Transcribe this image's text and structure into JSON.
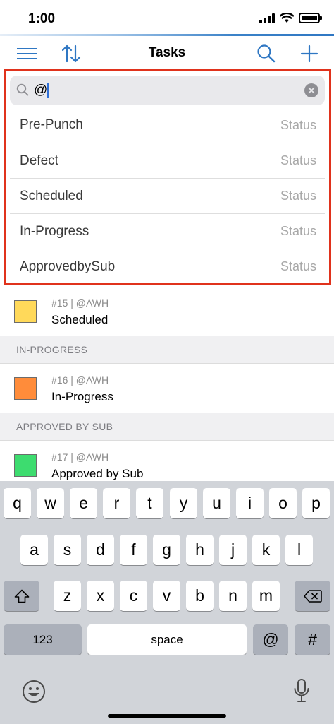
{
  "status_bar": {
    "time": "1:00"
  },
  "nav": {
    "title": "Tasks"
  },
  "search": {
    "value": "@"
  },
  "suggestions": [
    {
      "label": "Pre-Punch",
      "meta": "Status"
    },
    {
      "label": "Defect",
      "meta": "Status"
    },
    {
      "label": "Scheduled",
      "meta": "Status"
    },
    {
      "label": "In-Progress",
      "meta": "Status"
    },
    {
      "label": "ApprovedbySub",
      "meta": "Status"
    }
  ],
  "tasks": {
    "scheduled_item": {
      "meta": "#15 | @AWH",
      "title": "Scheduled",
      "color": "#ffd95a"
    },
    "in_progress_header": "IN-PROGRESS",
    "in_progress_item": {
      "meta": "#16 | @AWH",
      "title": "In-Progress",
      "color": "#ff8c3a"
    },
    "approved_header": "APPROVED BY  SUB",
    "approved_item": {
      "meta": "#17 | @AWH",
      "title": "Approved by Sub",
      "color": "#3ddc6f"
    }
  },
  "keyboard": {
    "row1": [
      "q",
      "w",
      "e",
      "r",
      "t",
      "y",
      "u",
      "i",
      "o",
      "p"
    ],
    "row2": [
      "a",
      "s",
      "d",
      "f",
      "g",
      "h",
      "j",
      "k",
      "l"
    ],
    "row3": [
      "z",
      "x",
      "c",
      "v",
      "b",
      "n",
      "m"
    ],
    "numbers_key": "123",
    "space_key": "space",
    "at_key": "@",
    "hash_key": "#"
  },
  "colors": {
    "accent": "#2f77c3",
    "highlight_border": "#e0321c"
  }
}
